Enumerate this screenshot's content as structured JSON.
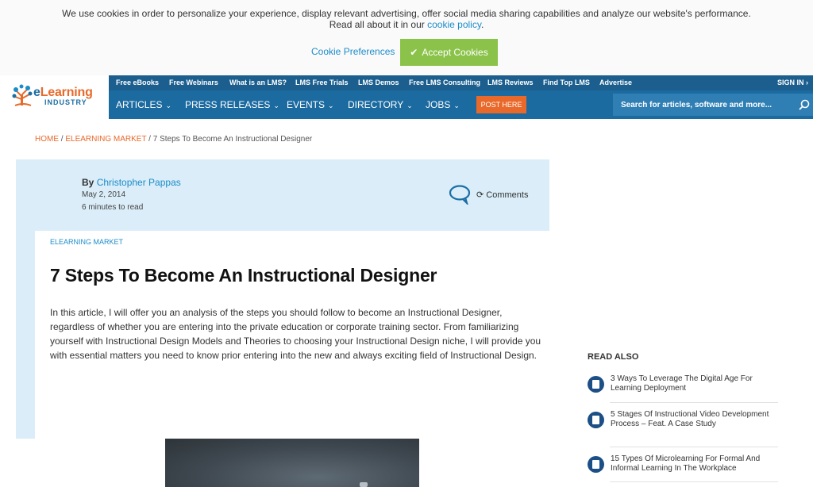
{
  "cookie_banner": {
    "line1": "We use cookies in order to personalize your experience, display relevant advertising, offer social media sharing capabilities and analyze our website's performance.",
    "line2_prefix": "Read all about it in our",
    "policy_link": "cookie policy",
    "line2_suffix": ".",
    "preferences_label": "Cookie Preferences",
    "accept_label": "Accept Cookies",
    "accept_color": "#8bc34a"
  },
  "logo": {
    "e": "e",
    "learning": "Learning",
    "industry": "INDUSTRY"
  },
  "top_nav": [
    "Free eBooks",
    "Free Webinars",
    "What is an LMS?",
    "LMS Free Trials",
    "LMS Demos",
    "Free LMS Consulting",
    "LMS Reviews",
    "Find Top LMS",
    "Advertise"
  ],
  "sign_in": "SIGN IN",
  "main_nav": [
    "ARTICLES",
    "PRESS RELEASES",
    "EVENTS",
    "DIRECTORY",
    "JOBS"
  ],
  "post_here": "POST HERE",
  "search": {
    "placeholder": "Search for articles, software and more..."
  },
  "breadcrumb": {
    "home": "HOME",
    "sep1": " / ",
    "category": "ELEARNING MARKET",
    "sep2": " / ",
    "current": "7 Steps To Become An Instructional Designer"
  },
  "article": {
    "by_label": "By ",
    "author": "Christopher Pappas",
    "date": "May 2, 2014",
    "read_time": "6 minutes to read",
    "comments_label": "Comments",
    "category": "ELEARNING MARKET",
    "title": "7 Steps To Become An Instructional Designer",
    "intro": "In this article, I will offer you an analysis of the steps you should follow to become an Instructional Designer, regardless of whether you are entering into the private education or corporate training sector. From familiarizing yourself with Instructional Design Models and Theories to choosing your Instructional Design niche, I will provide you with essential matters you need to know prior entering into the new and always exciting field of Instructional Design."
  },
  "read_also": {
    "heading": "READ ALSO",
    "items": [
      "3 Ways To Leverage The Digital Age For Learning Deployment",
      "5 Stages Of Instructional Video Development Process – Feat. A Case Study",
      "15 Types Of Microlearning For Formal And Informal Learning In The Workplace"
    ]
  },
  "colors": {
    "brand_blue": "#1b6aa0",
    "top_nav_blue": "#1c5f8f",
    "orange": "#e8692a",
    "light_blue_panel": "#daedf8"
  }
}
